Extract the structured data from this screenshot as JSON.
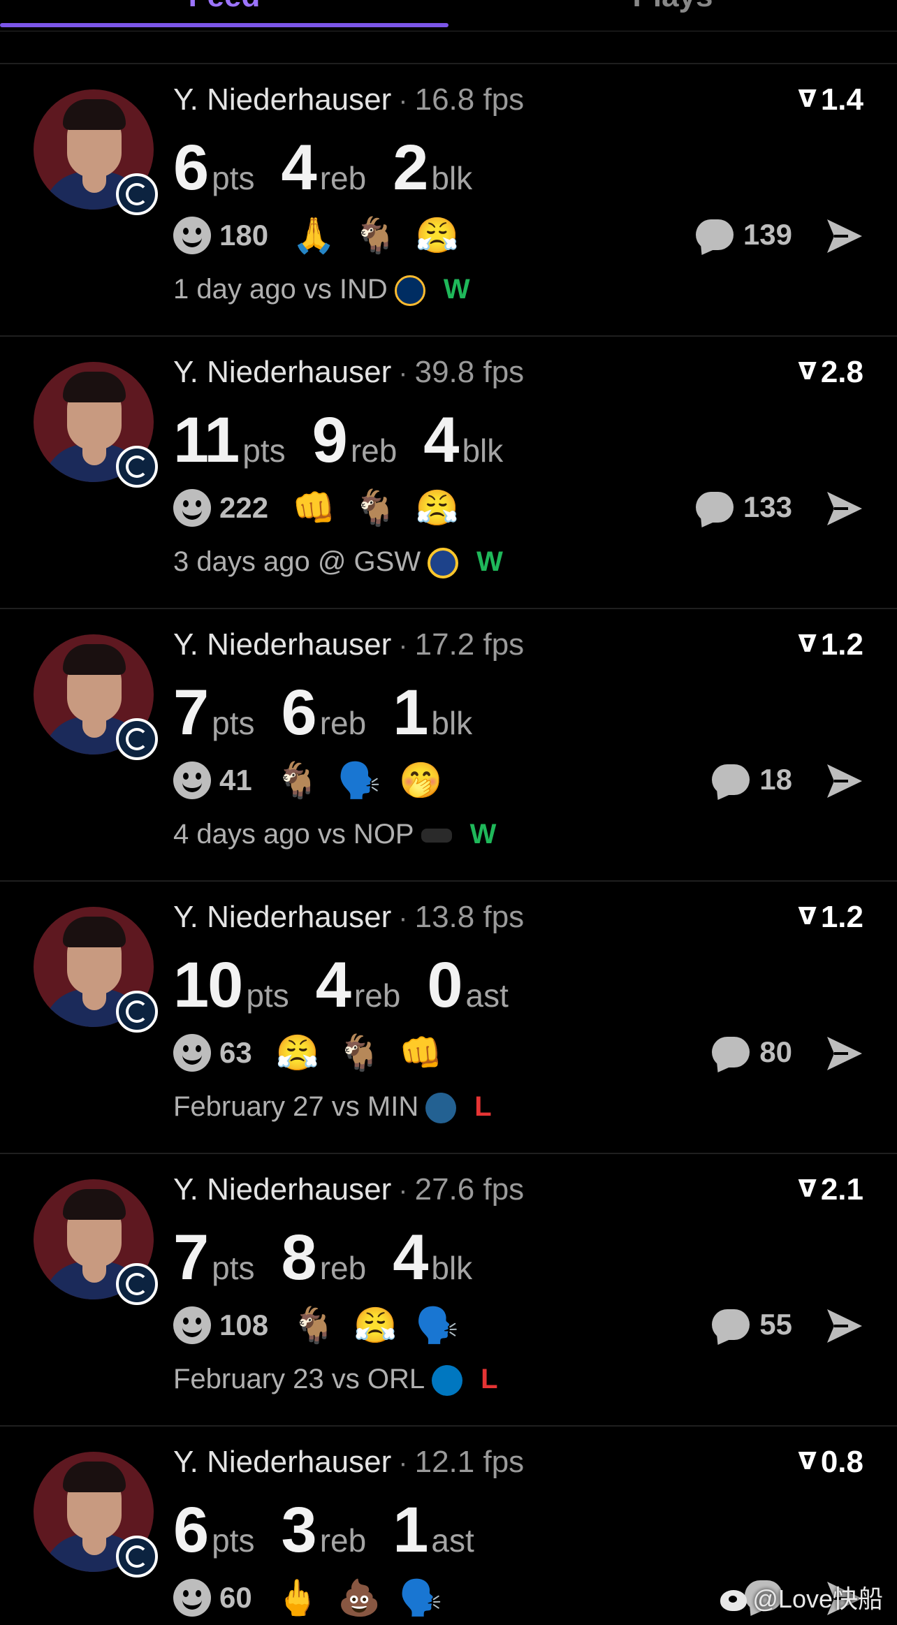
{
  "tabs": [
    "Feed",
    "Plays"
  ],
  "feed": {
    "items": [
      {
        "player": "Y. Niederhauser",
        "fps": "16.8 fps",
        "rating": "1.4",
        "stats": [
          {
            "num": "6",
            "unit": "pts"
          },
          {
            "num": "4",
            "unit": "reb"
          },
          {
            "num": "2",
            "unit": "blk"
          }
        ],
        "reaction_count": "180",
        "emojis": [
          "🙏",
          "🐐",
          "😤"
        ],
        "comment_count": "139",
        "game": "1 day ago vs IND",
        "opponent_logo": "pacers-logo",
        "result": "W",
        "result_color": "#1fb85a"
      },
      {
        "player": "Y. Niederhauser",
        "fps": "39.8 fps",
        "rating": "2.8",
        "stats": [
          {
            "num": "11",
            "unit": "pts"
          },
          {
            "num": "9",
            "unit": "reb"
          },
          {
            "num": "4",
            "unit": "blk"
          }
        ],
        "reaction_count": "222",
        "emojis": [
          "👊",
          "🐐",
          "😤"
        ],
        "comment_count": "133",
        "game": "3 days ago @ GSW",
        "opponent_logo": "warriors-logo",
        "result": "W",
        "result_color": "#1fb85a"
      },
      {
        "player": "Y. Niederhauser",
        "fps": "17.2 fps",
        "rating": "1.2",
        "stats": [
          {
            "num": "7",
            "unit": "pts"
          },
          {
            "num": "6",
            "unit": "reb"
          },
          {
            "num": "1",
            "unit": "blk"
          }
        ],
        "reaction_count": "41",
        "emojis": [
          "🐐",
          "🗣️",
          "🤭"
        ],
        "comment_count": "18",
        "game": "4 days ago vs NOP",
        "opponent_logo": "pelicans-logo",
        "result": "W",
        "result_color": "#1fb85a"
      },
      {
        "player": "Y. Niederhauser",
        "fps": "13.8 fps",
        "rating": "1.2",
        "stats": [
          {
            "num": "10",
            "unit": "pts"
          },
          {
            "num": "4",
            "unit": "reb"
          },
          {
            "num": "0",
            "unit": "ast"
          }
        ],
        "reaction_count": "63",
        "emojis": [
          "😤",
          "🐐",
          "👊"
        ],
        "comment_count": "80",
        "game": "February 27 vs MIN",
        "opponent_logo": "timberwolves-logo",
        "result": "L",
        "result_color": "#e63434"
      },
      {
        "player": "Y. Niederhauser",
        "fps": "27.6 fps",
        "rating": "2.1",
        "stats": [
          {
            "num": "7",
            "unit": "pts"
          },
          {
            "num": "8",
            "unit": "reb"
          },
          {
            "num": "4",
            "unit": "blk"
          }
        ],
        "reaction_count": "108",
        "emojis": [
          "🐐",
          "😤",
          "🗣️"
        ],
        "comment_count": "55",
        "game": "February 23 vs ORL",
        "opponent_logo": "magic-logo",
        "result": "L",
        "result_color": "#e63434"
      },
      {
        "player": "Y. Niederhauser",
        "fps": "12.1 fps",
        "rating": "0.8",
        "stats": [
          {
            "num": "6",
            "unit": "pts"
          },
          {
            "num": "3",
            "unit": "reb"
          },
          {
            "num": "1",
            "unit": "ast"
          }
        ],
        "reaction_count": "60",
        "emojis": [
          "🖕",
          "💩",
          "🗣️"
        ],
        "comment_count": "",
        "game": "",
        "opponent_logo": "",
        "result": "",
        "result_color": "#1fb85a"
      }
    ]
  },
  "watermark": "@Love快船",
  "colors": {
    "accent": "#7b55e8",
    "win": "#1fb85a",
    "loss": "#e63434",
    "team": "#5e1820"
  }
}
